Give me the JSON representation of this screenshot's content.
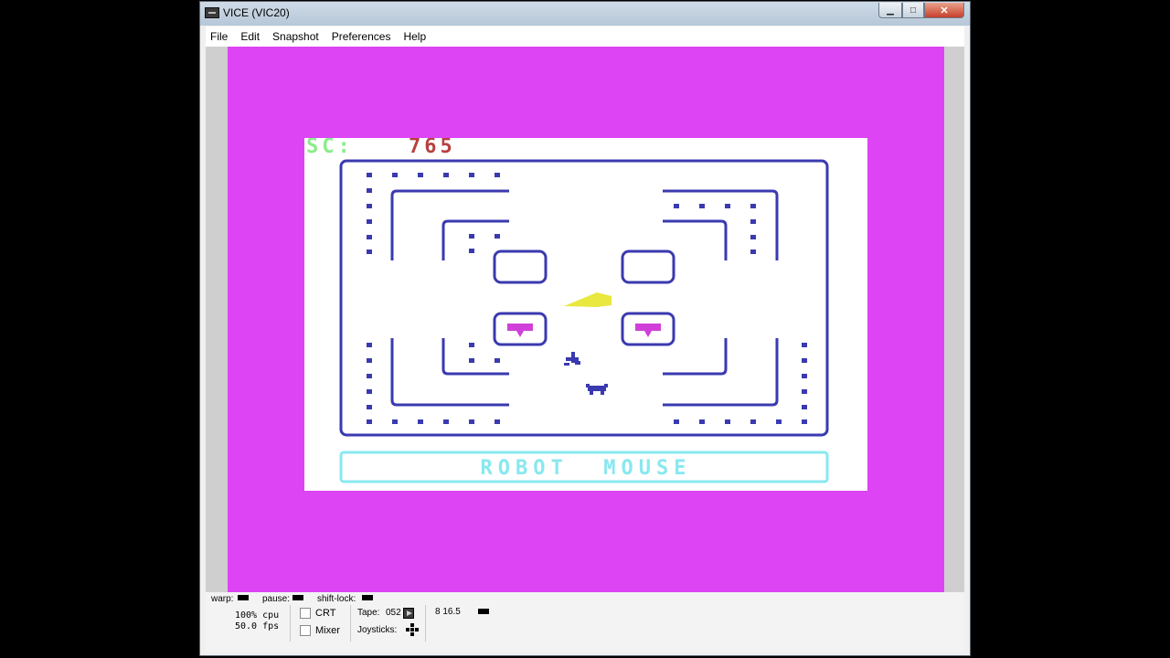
{
  "window": {
    "title": "VICE (VIC20)",
    "buttons": {
      "minimize": "▁",
      "maximize": "□",
      "close": "✕"
    }
  },
  "menu": [
    "File",
    "Edit",
    "Snapshot",
    "Preferences",
    "Help"
  ],
  "game": {
    "score_label": "SC:",
    "score_value": "765",
    "title_banner": "ROBOT  MOUSE",
    "colors": {
      "border": "#dd44f4",
      "screen": "#ffffff",
      "maze": "#3a3ab0",
      "score_label": "#88ee88",
      "score_value": "#b84040",
      "cheese": "#e8e840",
      "heart_block": "#d040d8",
      "banner": "#88e8f0"
    }
  },
  "status": {
    "warp_label": "warp:",
    "pause_label": "pause:",
    "shift_lock_label": "shift-lock:",
    "cpu": "100% cpu",
    "fps": "50.0 fps",
    "crt_label": "CRT",
    "mixer_label": "Mixer",
    "tape_label": "Tape:",
    "tape_counter": "052",
    "joysticks_label": "Joysticks:",
    "drive_readout": "8 16.5"
  }
}
